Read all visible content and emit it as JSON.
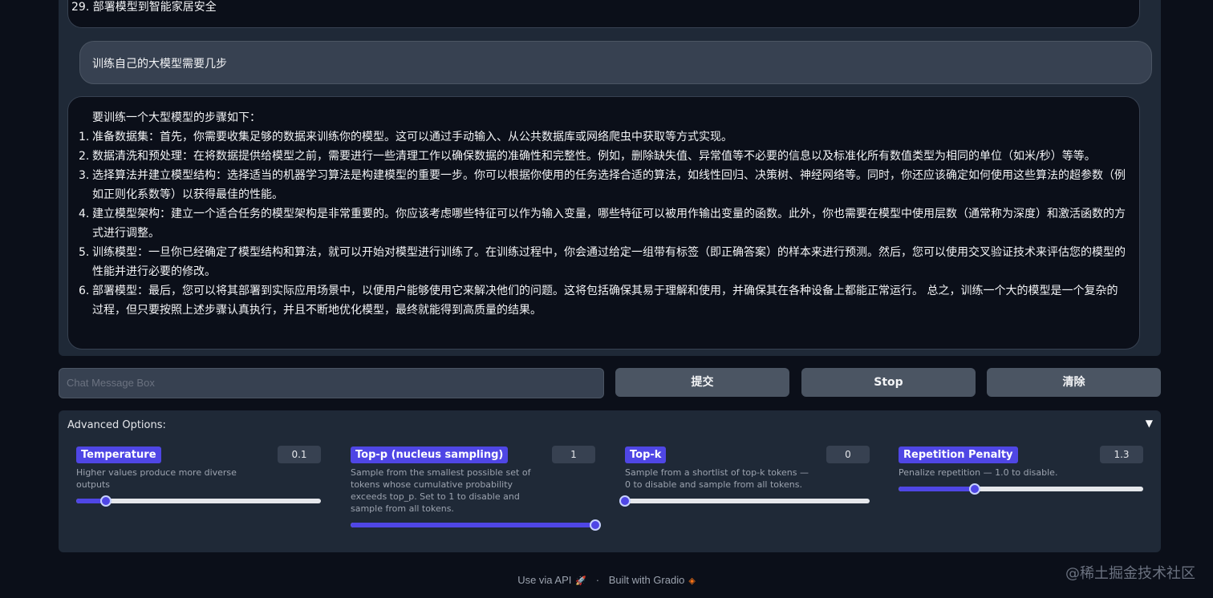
{
  "chat": {
    "prev_bot_tail": "29. 部署模型到智能家居安全",
    "user_message": "训练自己的大模型需要几步",
    "bot_intro": "要训练一个大型模型的步骤如下：",
    "bot_steps": [
      {
        "num": "1.",
        "text": "准备数据集：首先，你需要收集足够的数据来训练你的模型。这可以通过手动输入、从公共数据库或网络爬虫中获取等方式实现。"
      },
      {
        "num": "2.",
        "text": "数据清洗和预处理：在将数据提供给模型之前，需要进行一些清理工作以确保数据的准确性和完整性。例如，删除缺失值、异常值等不必要的信息以及标准化所有数值类型为相同的单位（如米/秒）等等。"
      },
      {
        "num": "3.",
        "text": "选择算法并建立模型结构：选择适当的机器学习算法是构建模型的重要一步。你可以根据你使用的任务选择合适的算法，如线性回归、决策树、神经网络等。同时，你还应该确定如何使用这些算法的超参数（例如正则化系数等）以获得最佳的性能。"
      },
      {
        "num": "4.",
        "text": "建立模型架构：建立一个适合任务的模型架构是非常重要的。你应该考虑哪些特征可以作为输入变量，哪些特征可以被用作输出变量的函数。此外，你也需要在模型中使用层数（通常称为深度）和激活函数的方式进行调整。"
      },
      {
        "num": "5.",
        "text": "训练模型：一旦你已经确定了模型结构和算法，就可以开始对模型进行训练了。在训练过程中，你会通过给定一组带有标签（即正确答案）的样本来进行预测。然后，您可以使用交叉验证技术来评估您的模型的性能并进行必要的修改。"
      },
      {
        "num": "6.",
        "text": "部署模型：最后，您可以将其部署到实际应用场景中，以便用户能够使用它来解决他们的问题。这将包括确保其易于理解和使用，并确保其在各种设备上都能正常运行。 总之，训练一个大的模型是一个复杂的过程，但只要按照上述步骤认真执行，并且不断地优化模型，最终就能得到高质量的结果。"
      }
    ]
  },
  "input": {
    "placeholder": "Chat Message Box"
  },
  "buttons": {
    "submit": "提交",
    "stop": "Stop",
    "clear": "清除"
  },
  "advanced": {
    "title": "Advanced Options:",
    "caret": "▼",
    "sliders": [
      {
        "label": "Temperature",
        "value": "0.1",
        "desc": "Higher values produce more diverse outputs",
        "fraction": 0.12
      },
      {
        "label": "Top-p (nucleus sampling)",
        "value": "1",
        "desc": "Sample from the smallest possible set of tokens whose cumulative probability exceeds top_p. Set to 1 to disable and sample from all tokens.",
        "fraction": 1.0
      },
      {
        "label": "Top-k",
        "value": "0",
        "desc": "Sample from a shortlist of top-k tokens — 0 to disable and sample from all tokens.",
        "fraction": 0.0
      },
      {
        "label": "Repetition Penalty",
        "value": "1.3",
        "desc": "Penalize repetition — 1.0 to disable.",
        "fraction": 0.31
      }
    ]
  },
  "footer": {
    "api": "Use via API",
    "api_icon": "🚀",
    "sep": "·",
    "built": "Built with Gradio",
    "built_icon": "gradio-logo-icon"
  },
  "watermark": "@稀土掘金技术社区"
}
